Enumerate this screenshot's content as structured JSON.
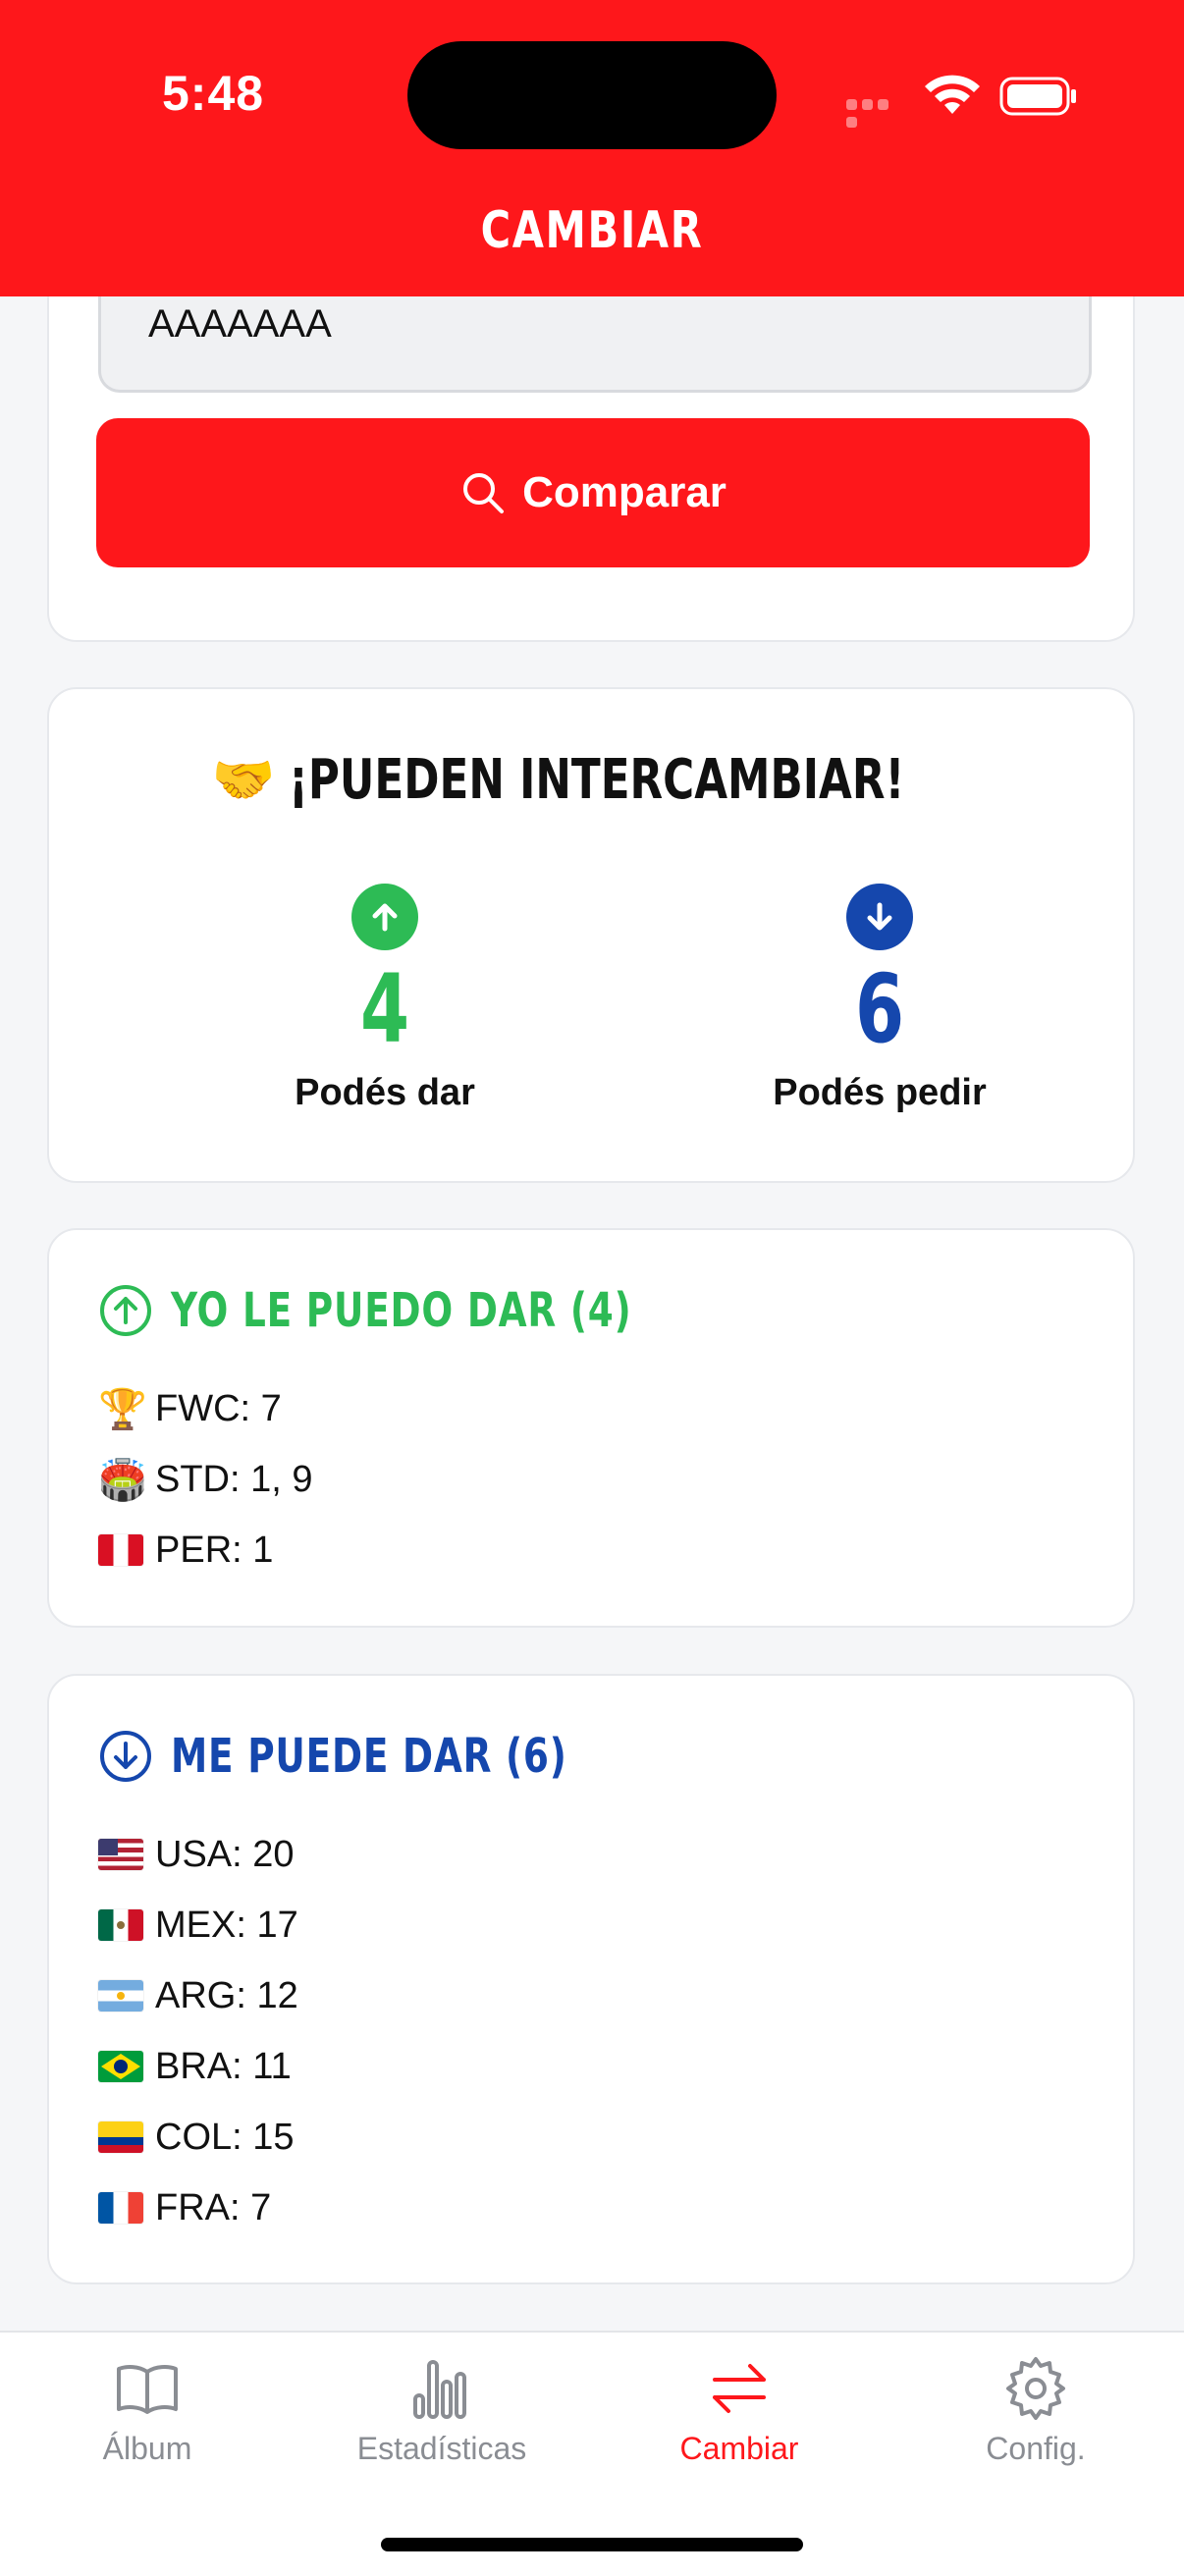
{
  "status_bar": {
    "time": "5:48"
  },
  "header": {
    "title": "CAMBIAR"
  },
  "search": {
    "code_value": "AAAAAAA",
    "compare_label": "Comparar"
  },
  "summary": {
    "title_emoji": "🤝",
    "title": "¡PUEDEN INTERCAMBIAR!",
    "give_count": "4",
    "give_label": "Podés dar",
    "ask_count": "6",
    "ask_label": "Podés pedir"
  },
  "give_list": {
    "title": "YO LE PUEDO DAR (4)",
    "items": [
      {
        "icon": "trophy-icon",
        "emoji": "🏆",
        "text": "FWC: 7"
      },
      {
        "icon": "stadium-icon",
        "emoji": "🏟️",
        "text": "STD: 1, 9"
      },
      {
        "icon": "peru-flag-icon",
        "flag": "PER",
        "text": "PER: 1"
      }
    ]
  },
  "get_list": {
    "title": "ME PUEDE DAR (6)",
    "items": [
      {
        "flag": "USA",
        "text": "USA: 20"
      },
      {
        "flag": "MEX",
        "text": "MEX: 17"
      },
      {
        "flag": "ARG",
        "text": "ARG: 12"
      },
      {
        "flag": "BRA",
        "text": "BRA: 11"
      },
      {
        "flag": "COL",
        "text": "COL: 15"
      },
      {
        "flag": "FRA",
        "text": "FRA: 7"
      }
    ]
  },
  "tabs": [
    {
      "label": "Álbum",
      "icon": "book-icon",
      "active": false
    },
    {
      "label": "Estadísticas",
      "icon": "bar-chart-icon",
      "active": false
    },
    {
      "label": "Cambiar",
      "icon": "swap-arrows-icon",
      "active": true
    },
    {
      "label": "Config.",
      "icon": "gear-icon",
      "active": false
    }
  ],
  "colors": {
    "brand_red": "#fe171b",
    "give_green": "#2dbb55",
    "get_blue": "#1547ad"
  }
}
